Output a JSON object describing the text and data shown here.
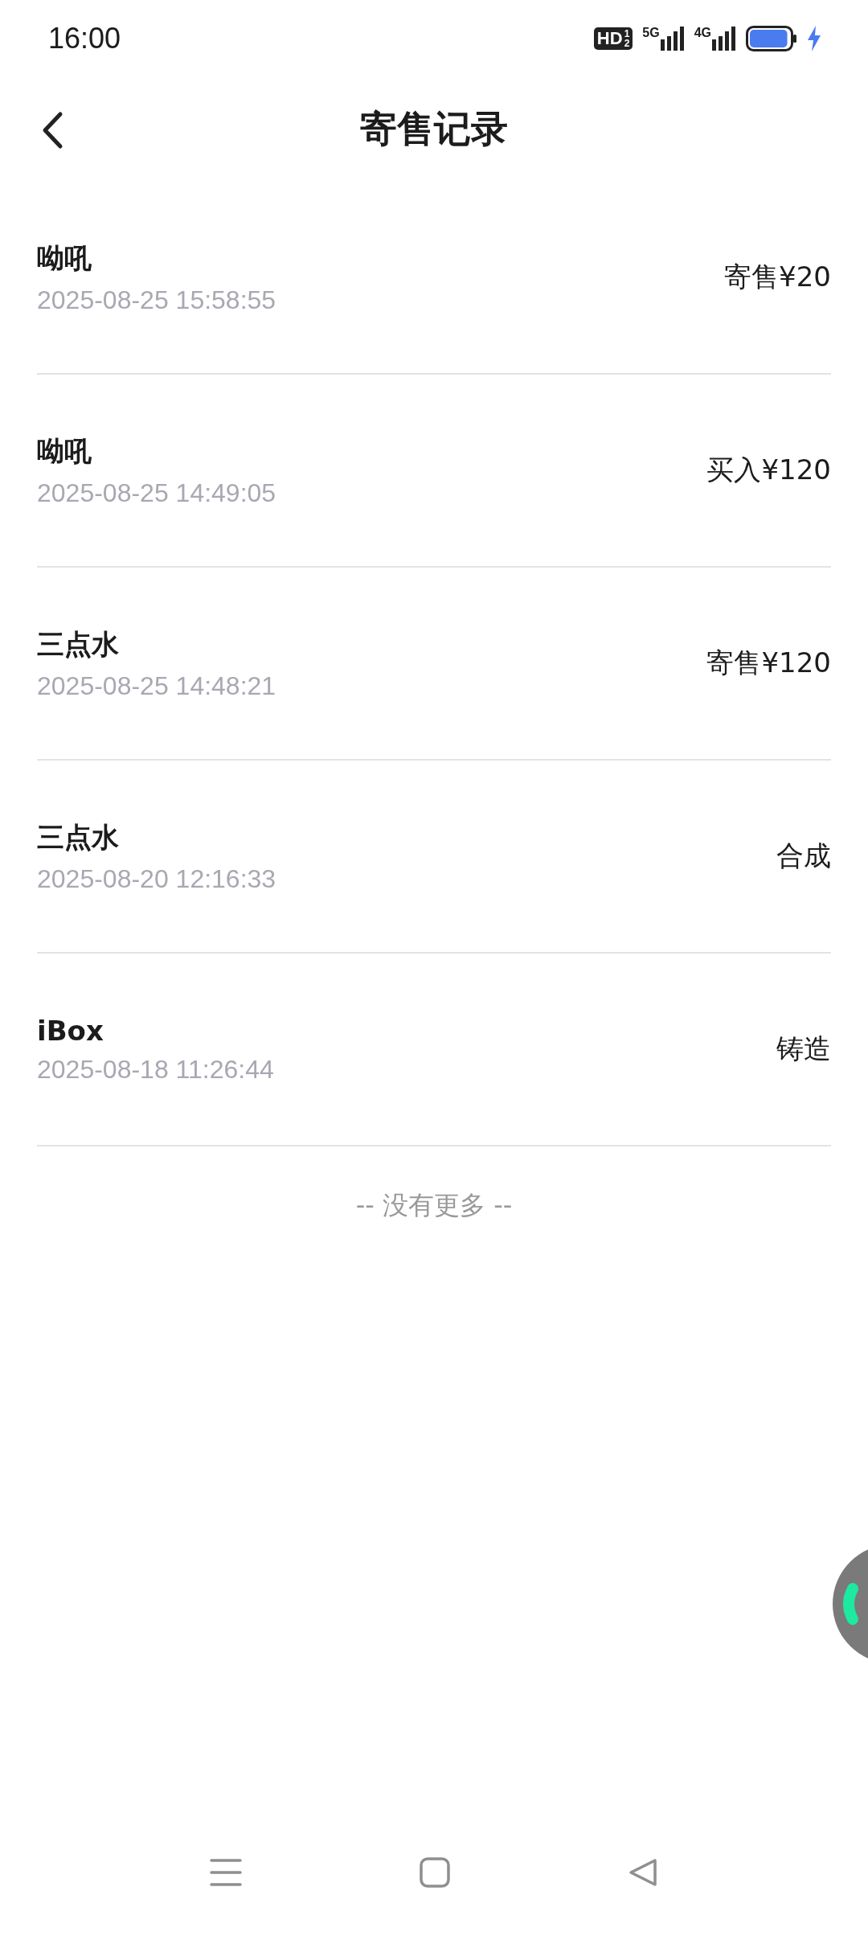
{
  "status_bar": {
    "time": "16:00",
    "hd": {
      "label": "HD",
      "slots": [
        "1",
        "2"
      ]
    },
    "networks": [
      "5G",
      "4G"
    ],
    "charging": true,
    "battery": {
      "level": 0.95
    }
  },
  "header": {
    "title": "寄售记录"
  },
  "records": [
    {
      "name": "呦吼",
      "time": "2025-08-25 15:58:55",
      "action": "寄售¥20"
    },
    {
      "name": "呦吼",
      "time": "2025-08-25 14:49:05",
      "action": "买入¥120"
    },
    {
      "name": "三点水",
      "time": "2025-08-25 14:48:21",
      "action": "寄售¥120"
    },
    {
      "name": "三点水",
      "time": "2025-08-20 12:16:33",
      "action": "合成"
    },
    {
      "name": "iBox",
      "time": "2025-08-18 11:26:44",
      "action": "铸造"
    }
  ],
  "footer": "-- 没有更多 --"
}
